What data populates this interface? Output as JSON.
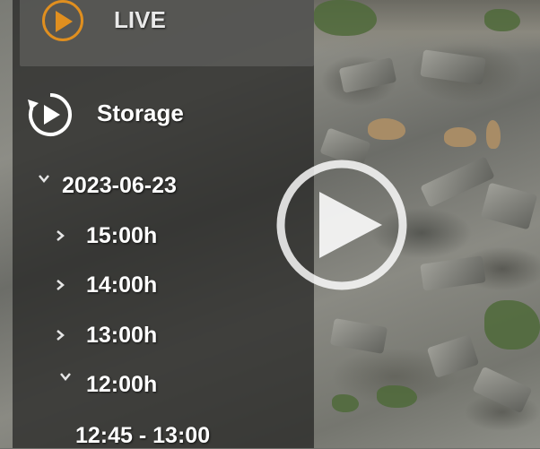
{
  "menu": {
    "live": {
      "label": "LIVE",
      "icon": "play-circle-icon",
      "accent": "#e08f1f"
    },
    "storage": {
      "label": "Storage",
      "icon": "replay-circle-icon"
    },
    "date": {
      "label": "2023-06-23",
      "expanded": true
    },
    "hours": [
      {
        "label": "15:00h",
        "expanded": false
      },
      {
        "label": "14:00h",
        "expanded": false
      },
      {
        "label": "13:00h",
        "expanded": false
      },
      {
        "label": "12:00h",
        "expanded": true
      }
    ],
    "range": {
      "label": "12:45 - 13:00"
    }
  },
  "player": {
    "overlay_icon": "play-icon"
  }
}
